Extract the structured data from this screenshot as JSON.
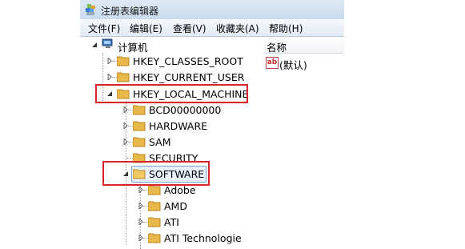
{
  "window": {
    "title": "注册表编辑器"
  },
  "menu": [
    "文件(F)",
    "编辑(E)",
    "查看(V)",
    "收藏夹(A)",
    "帮助(H)"
  ],
  "tree": {
    "root": "计算机",
    "items": [
      {
        "label": "HKEY_CLASSES_ROOT",
        "expanded": false
      },
      {
        "label": "HKEY_CURRENT_USER",
        "expanded": false
      },
      {
        "label": "HKEY_LOCAL_MACHINE",
        "expanded": true
      },
      {
        "label": "BCD00000000",
        "expanded": false
      },
      {
        "label": "HARDWARE",
        "expanded": false
      },
      {
        "label": "SAM",
        "expanded": false
      },
      {
        "label": "SECURITY",
        "expanded": false
      },
      {
        "label": "SOFTWARE",
        "expanded": true,
        "selected": true
      },
      {
        "label": "Adobe",
        "expanded": false
      },
      {
        "label": "AMD",
        "expanded": false
      },
      {
        "label": "ATI",
        "expanded": false
      },
      {
        "label": "ATI Technologie",
        "expanded": false
      }
    ]
  },
  "values_pane": {
    "column_header": "名称",
    "rows": [
      {
        "icon": "ab-string-icon",
        "name": "(默认)"
      }
    ]
  },
  "colors": {
    "highlight_box": "#d8232a",
    "folder": "#e8b84a",
    "selection": "#e8f1fb"
  }
}
